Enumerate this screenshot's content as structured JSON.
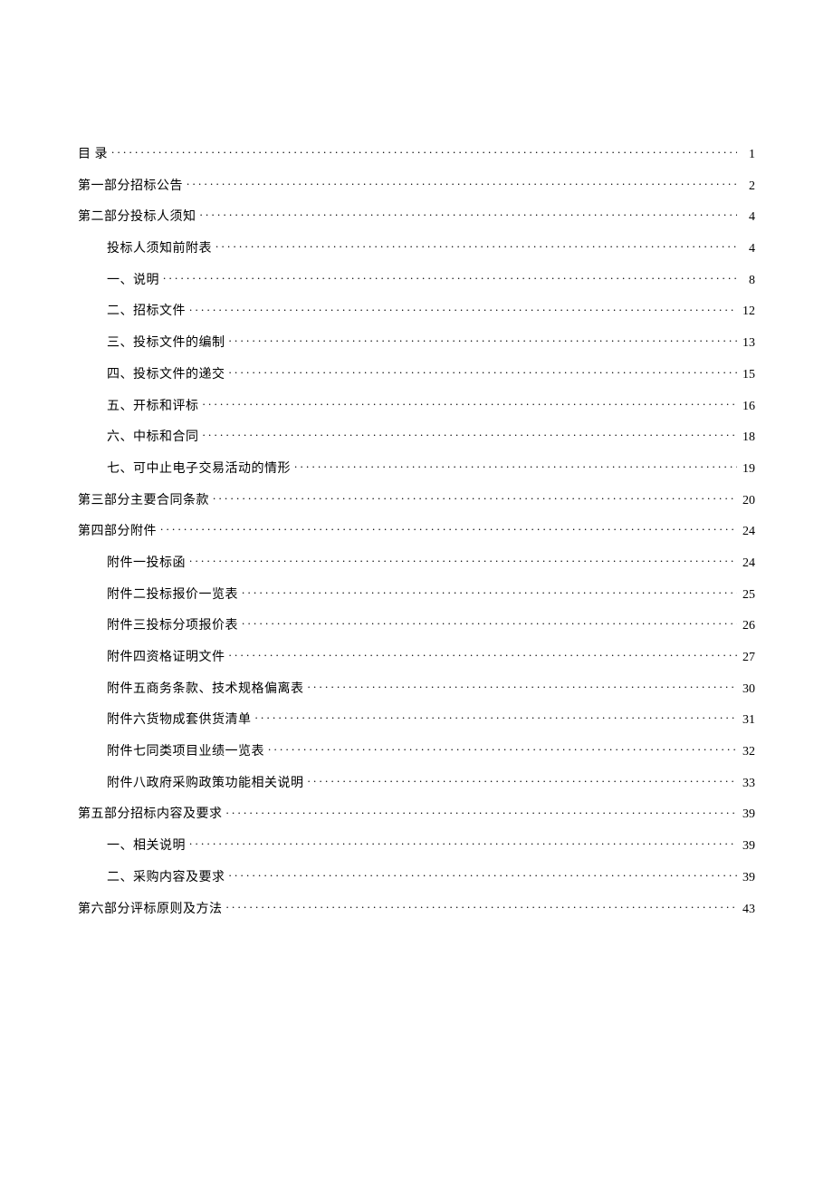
{
  "toc": [
    {
      "level": 1,
      "label": "目 录",
      "page": "1"
    },
    {
      "level": 1,
      "label": "第一部分招标公告",
      "page": "2"
    },
    {
      "level": 1,
      "label": "第二部分投标人须知",
      "page": "4"
    },
    {
      "level": 2,
      "label": "投标人须知前附表",
      "page": "4"
    },
    {
      "level": 2,
      "label": "一、说明",
      "page": "8"
    },
    {
      "level": 2,
      "label": "二、招标文件",
      "page": "12"
    },
    {
      "level": 2,
      "label": "三、投标文件的编制",
      "page": "13"
    },
    {
      "level": 2,
      "label": "四、投标文件的递交",
      "page": "15"
    },
    {
      "level": 2,
      "label": "五、开标和评标",
      "page": "16"
    },
    {
      "level": 2,
      "label": "六、中标和合同",
      "page": "18"
    },
    {
      "level": 2,
      "label": "七、可中止电子交易活动的情形",
      "page": "19"
    },
    {
      "level": 1,
      "label": "第三部分主要合同条款",
      "page": "20"
    },
    {
      "level": 1,
      "label": "第四部分附件",
      "page": "24"
    },
    {
      "level": 2,
      "label": "附件一投标函",
      "page": "24"
    },
    {
      "level": 2,
      "label": "附件二投标报价一览表",
      "page": "25"
    },
    {
      "level": 2,
      "label": "附件三投标分项报价表",
      "page": "26"
    },
    {
      "level": 2,
      "label": "附件四资格证明文件",
      "page": "27"
    },
    {
      "level": 2,
      "label": "附件五商务条款、技术规格偏离表",
      "page": "30"
    },
    {
      "level": 2,
      "label": "附件六货物成套供货清单",
      "page": "31"
    },
    {
      "level": 2,
      "label": "附件七同类项目业绩一览表",
      "page": "32"
    },
    {
      "level": 2,
      "label": "附件八政府采购政策功能相关说明",
      "page": "33"
    },
    {
      "level": 1,
      "label": "第五部分招标内容及要求",
      "page": "39"
    },
    {
      "level": 2,
      "label": "一、相关说明",
      "page": "39"
    },
    {
      "level": 2,
      "label": "二、采购内容及要求",
      "page": "39"
    },
    {
      "level": 1,
      "label": "第六部分评标原则及方法",
      "page": "43"
    }
  ]
}
